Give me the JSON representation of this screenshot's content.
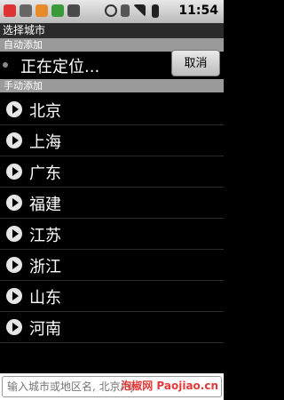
{
  "status_bar": {
    "time": "11:54"
  },
  "title": "选择城市",
  "auto_section": {
    "label": "自动添加",
    "locating_text": "正在定位...",
    "cancel_label": "取消"
  },
  "manual_section": {
    "label": "手动添加"
  },
  "cities": [
    "北京",
    "上海",
    "广东",
    "福建",
    "江苏",
    "浙江",
    "山东",
    "河南"
  ],
  "search": {
    "placeholder": "输入城市或地区名, 北京/bj"
  },
  "watermark": "泡椒网 Paojiao.cn",
  "colors": {
    "section_bg": "#9a9a9a",
    "list_bg": "#000000"
  }
}
